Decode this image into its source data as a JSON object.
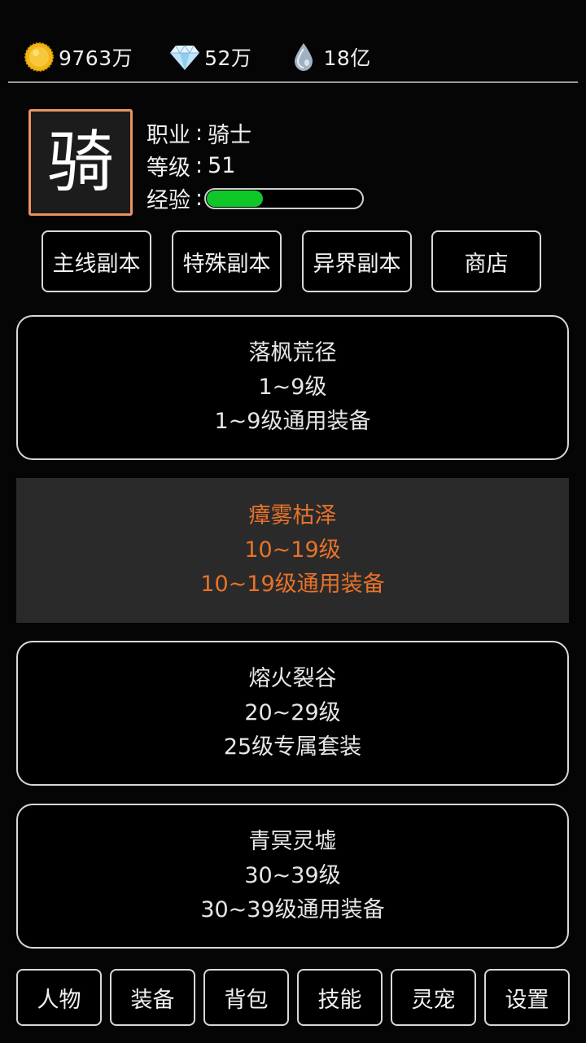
{
  "currency": {
    "gold": {
      "icon": "gold-coin-icon",
      "value": "9763万"
    },
    "diamond": {
      "icon": "diamond-icon",
      "value": "52万"
    },
    "essence": {
      "icon": "water-drop-icon",
      "value": "18亿"
    }
  },
  "character": {
    "badge_char": "骑",
    "job_label": "职业",
    "job_value": "骑士",
    "level_label": "等级",
    "level_value": "51",
    "exp_label": "经验",
    "exp_fraction": 0.37,
    "separator": ":",
    "badge_border_color": "#e9935f",
    "exp_color": "#10c72a"
  },
  "tabs": [
    {
      "label": "主线副本"
    },
    {
      "label": "特殊副本"
    },
    {
      "label": "异界副本"
    },
    {
      "label": "商店"
    }
  ],
  "dungeons": [
    {
      "name": "落枫荒径",
      "level": "1~9级",
      "reward": "1~9级通用装备",
      "selected": false
    },
    {
      "name": "瘴雾枯泽",
      "level": "10~19级",
      "reward": "10~19级通用装备",
      "selected": true
    },
    {
      "name": "熔火裂谷",
      "level": "20~29级",
      "reward": "25级专属套装",
      "selected": false
    },
    {
      "name": "青冥灵墟",
      "level": "30~39级",
      "reward": "30~39级通用装备",
      "selected": false
    }
  ],
  "bottom_nav": [
    {
      "label": "人物"
    },
    {
      "label": "装备"
    },
    {
      "label": "背包"
    },
    {
      "label": "技能"
    },
    {
      "label": "灵宠"
    },
    {
      "label": "设置"
    }
  ],
  "colors": {
    "selected_text": "#e8722a",
    "selected_bg": "#2a2a2a",
    "border": "#d8d8d8"
  }
}
